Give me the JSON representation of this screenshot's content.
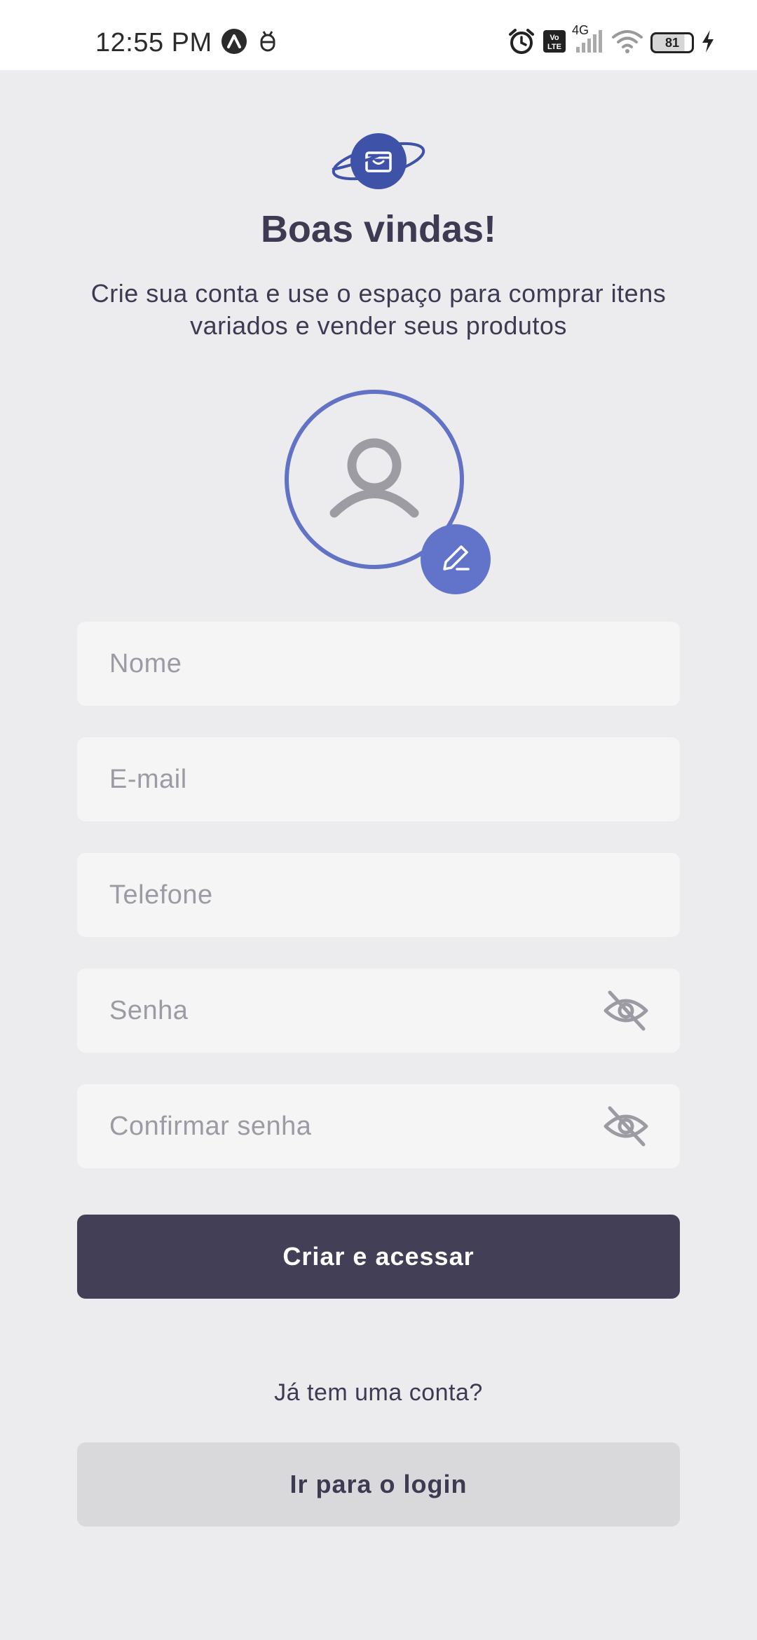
{
  "status_bar": {
    "time": "12:55 PM",
    "network": "4G",
    "volte": "Vo LTE",
    "battery": "81"
  },
  "header": {
    "title": "Boas vindas!",
    "subtitle": "Crie sua conta e use o espaço para comprar itens variados e vender seus produtos"
  },
  "form": {
    "name_placeholder": "Nome",
    "email_placeholder": "E-mail",
    "phone_placeholder": "Telefone",
    "password_placeholder": "Senha",
    "confirm_password_placeholder": "Confirmar senha",
    "submit_label": "Criar e acessar"
  },
  "footer": {
    "prompt": "Já tem uma conta?",
    "login_label": "Ir para o login"
  },
  "colors": {
    "background": "#ECECEF",
    "primary_dark": "#423F57",
    "accent_blue": "#6274CA",
    "logo_blue": "#3E52A8",
    "input_bg": "#F5F5F6",
    "secondary_button": "#D9D9DC"
  },
  "icons": [
    "app-alert-icon",
    "bug-icon",
    "alarm-icon",
    "volte-icon",
    "signal-icon",
    "wifi-icon",
    "battery-icon",
    "charging-icon",
    "logo-icon",
    "user-icon",
    "pencil-icon",
    "eye-off-icon"
  ]
}
